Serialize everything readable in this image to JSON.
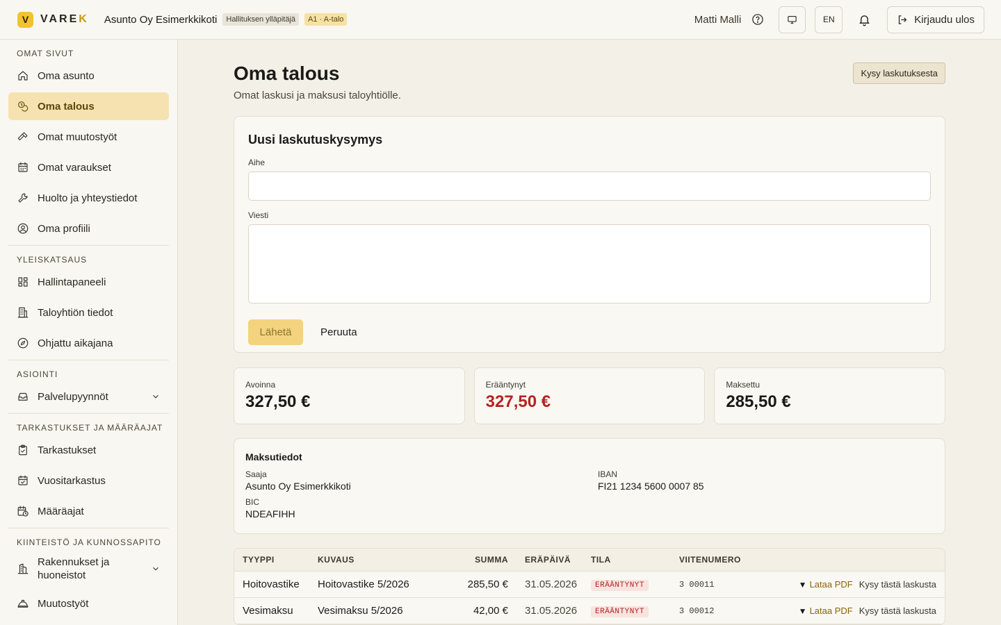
{
  "header": {
    "logo_mark": "V",
    "logo_word": "VARE",
    "logo_word_end": "K",
    "org_name": "Asunto Oy Esimerkkikoti",
    "role_badge": "Hallituksen ylläpitäjä",
    "unit_badge": "A1 · A-talo",
    "user_name": "Matti Malli",
    "lang_label": "EN",
    "logout_label": "Kirjaudu ulos"
  },
  "sidebar": {
    "sections": [
      {
        "heading": "OMAT SIVUT",
        "items": [
          {
            "label": "Oma asunto",
            "icon": "home-icon"
          },
          {
            "label": "Oma talous",
            "icon": "coins-icon",
            "active": true
          },
          {
            "label": "Omat muutostyöt",
            "icon": "hammer-icon"
          },
          {
            "label": "Omat varaukset",
            "icon": "calendar-icon"
          },
          {
            "label": "Huolto ja yhteystiedot",
            "icon": "wrench-icon"
          },
          {
            "label": "Oma profiili",
            "icon": "user-circle-icon"
          }
        ]
      },
      {
        "heading": "YLEISKATSAUS",
        "items": [
          {
            "label": "Hallintapaneeli",
            "icon": "dashboard-icon"
          },
          {
            "label": "Taloyhtiön tiedot",
            "icon": "building-icon"
          },
          {
            "label": "Ohjattu aikajana",
            "icon": "compass-icon"
          }
        ]
      },
      {
        "heading": "ASIOINTI",
        "items": [
          {
            "label": "Palvelupyynnöt",
            "icon": "inbox-icon",
            "expandable": true
          }
        ]
      },
      {
        "heading": "TARKASTUKSET JA MÄÄRÄAJAT",
        "items": [
          {
            "label": "Tarkastukset",
            "icon": "clipboard-check-icon"
          },
          {
            "label": "Vuositarkastus",
            "icon": "calendar-check-icon"
          },
          {
            "label": "Määräajat",
            "icon": "calendar-clock-icon"
          }
        ]
      },
      {
        "heading": "KIINTEISTÖ JA KUNNOSSAPITO",
        "items": [
          {
            "label": "Rakennukset ja huoneistot",
            "icon": "buildings-icon",
            "expandable": true
          },
          {
            "label": "Muutostyöt",
            "icon": "hardhat-icon"
          }
        ]
      }
    ]
  },
  "page": {
    "title": "Oma talous",
    "subtitle": "Omat laskusi ja maksusi taloyhtiölle.",
    "ask_button": "Kysy laskutuksesta"
  },
  "form": {
    "title": "Uusi laskutuskysymys",
    "subject_label": "Aihe",
    "subject_value": "",
    "message_label": "Viesti",
    "message_value": "",
    "send_label": "Lähetä",
    "cancel_label": "Peruuta"
  },
  "stats": [
    {
      "label": "Avoinna",
      "value": "327,50 €",
      "color": "#1c1a16"
    },
    {
      "label": "Erääntynyt",
      "value": "327,50 €",
      "color": "#b42323"
    },
    {
      "label": "Maksettu",
      "value": "285,50 €",
      "color": "#1c1a16"
    }
  ],
  "payment": {
    "title": "Maksutiedot",
    "recipient_label": "Saaja",
    "recipient_value": "Asunto Oy Esimerkkikoti",
    "iban_label": "IBAN",
    "iban_value": "FI21 1234 5600 0007 85",
    "bic_label": "BIC",
    "bic_value": "NDEAFIHH"
  },
  "table": {
    "columns": [
      "TYYPPI",
      "KUVAUS",
      "SUMMA",
      "ERÄPÄIVÄ",
      "TILA",
      "VIITENUMERO"
    ],
    "rows": [
      {
        "type": "Hoitovastike",
        "description": "Hoitovastike 5/2026",
        "amount": "285,50 €",
        "due": "31.05.2026",
        "status": "ERÄÄNTYNYT",
        "reference": "3 00011",
        "pdf_label": "Lataa PDF",
        "ask_label": "Kysy tästä laskusta"
      },
      {
        "type": "Vesimaksu",
        "description": "Vesimaksu 5/2026",
        "amount": "42,00 €",
        "due": "31.05.2026",
        "status": "ERÄÄNTYNYT",
        "reference": "3 00012",
        "pdf_label": "Lataa PDF",
        "ask_label": "Kysy tästä laskusta"
      }
    ]
  }
}
